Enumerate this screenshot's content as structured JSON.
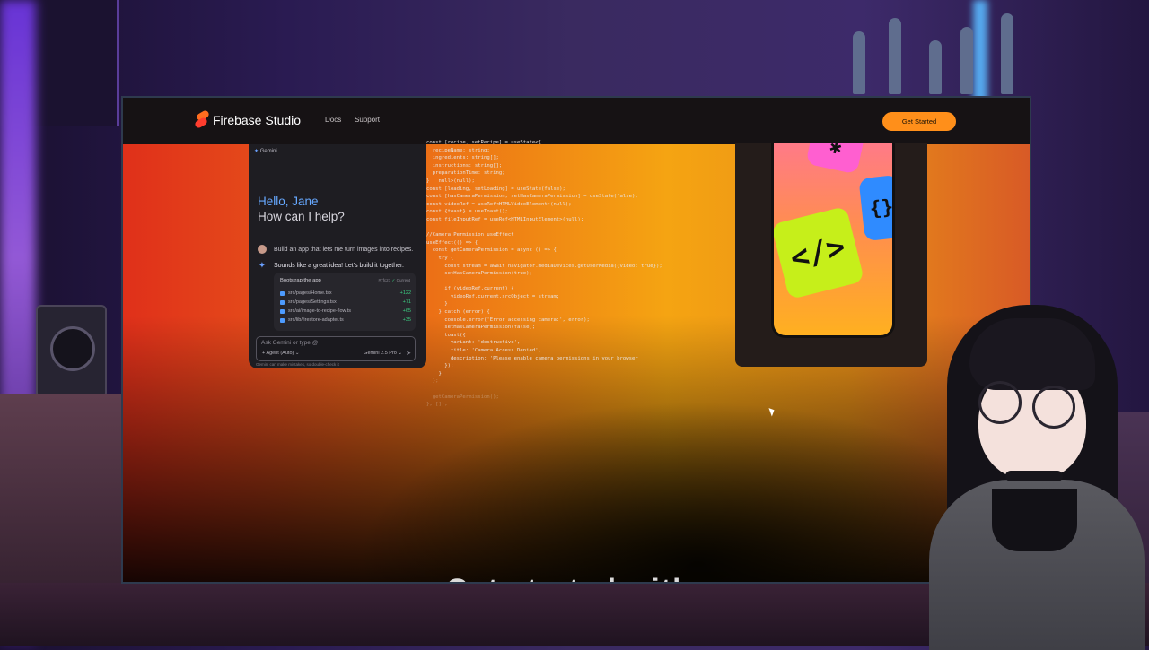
{
  "site": {
    "brand": "Firebase Studio",
    "nav": [
      "Docs",
      "Support"
    ],
    "cta": "Get Started",
    "hero_partial": "Get started with"
  },
  "chat": {
    "top_label": "Gemini",
    "greeting": "Hello, Jane",
    "subgreeting": "How can I help?",
    "user_message": "Build an app that lets me turn images into recipes.",
    "assistant_message": "Sounds like a great idea! Let's build it together.",
    "card": {
      "title": "Bootstrap the app",
      "version": "#7fc21",
      "status": "Current",
      "files": [
        {
          "path": "src/pages/Home.tsx",
          "delta": "+122"
        },
        {
          "path": "src/pages/Settings.tsx",
          "delta": "+71"
        },
        {
          "path": "src/ai/image-to-recipe-flow.ts",
          "delta": "+65"
        },
        {
          "path": "src/lib/firestore-adapter.ts",
          "delta": "+35"
        }
      ]
    },
    "input_placeholder": "Ask Gemini or type @",
    "agent_label": "Agent (Auto)",
    "model_label": "Gemini 2.5 Pro",
    "disclaimer": "Gemini can make mistakes, so double-check it"
  },
  "code_lines": [
    "const [recipe, setRecipe] = useState<{",
    "  recipeName: string;",
    "  ingredients: string[];",
    "  instructions: string[];",
    "  preparationTime: string;",
    "} | null>(null);",
    "const [loading, setLoading] = useState(false);",
    "const [hasCameraPermission, setHasCameraPermission] = useState(false);",
    "const videoRef = useRef<HTMLVideoElement>(null);",
    "const {toast} = useToast();",
    "const fileInputRef = useRef<HTMLInputElement>(null);",
    "",
    "//Camera Permission useEffect",
    "useEffect(() => {",
    "  const getCameraPermission = async () => {",
    "    try {",
    "      const stream = await navigator.mediaDevices.getUserMedia({video: true});",
    "      setHasCameraPermission(true);",
    "",
    "      if (videoRef.current) {",
    "        videoRef.current.srcObject = stream;",
    "      }",
    "    } catch (error) {",
    "      console.error('Error accessing camera:', error);",
    "      setHasCameraPermission(false);",
    "      toast({",
    "        variant: 'destructive',",
    "        title: 'Camera Access Denied',",
    "        description: 'Please enable camera permissions in your browser",
    "      });",
    "    }",
    "  };",
    "",
    "  getCameraPermission();",
    "}, []);"
  ],
  "colors": {
    "accent_orange": "#ff8f1a",
    "gemini_blue": "#66a8ff",
    "diff_green": "#3ccf82"
  }
}
